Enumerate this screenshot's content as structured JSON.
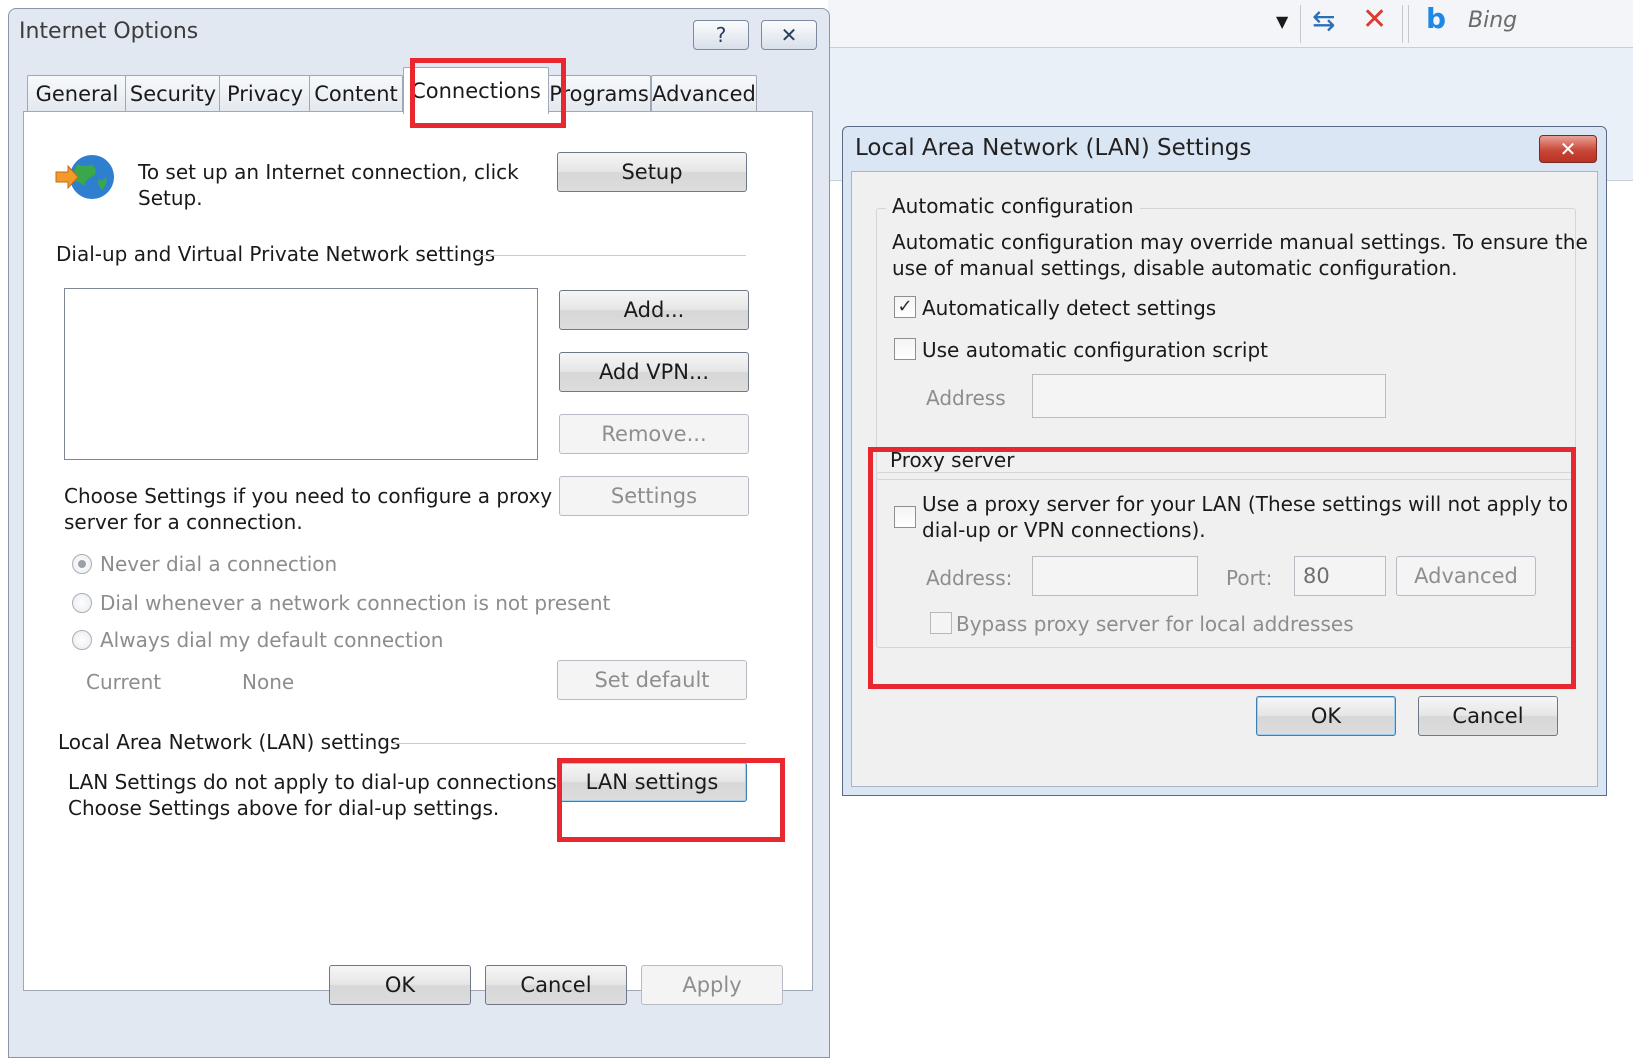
{
  "browser": {
    "search_provider": "Bing"
  },
  "internet_options": {
    "title": "Internet Options",
    "help_glyph": "?",
    "close_glyph": "✕",
    "tabs": [
      "General",
      "Security",
      "Privacy",
      "Content",
      "Connections",
      "Programs",
      "Advanced"
    ],
    "active_tab": "Connections",
    "setup_text_line1": "To set up an Internet connection, click",
    "setup_text_line2": "Setup.",
    "setup_button": "Setup",
    "dialup_group_label": "Dial-up and Virtual Private Network settings",
    "add_button": "Add...",
    "add_vpn_button": "Add VPN...",
    "remove_button": "Remove...",
    "settings_button": "Settings",
    "proxy_hint_line1": "Choose Settings if you need to configure a proxy",
    "proxy_hint_line2": "server for a connection.",
    "radio_never": "Never dial a connection",
    "radio_whenever": "Dial whenever a network connection is not present",
    "radio_always": "Always dial my default connection",
    "current_label": "Current",
    "current_value": "None",
    "set_default_button": "Set default",
    "lan_group_label": "Local Area Network (LAN) settings",
    "lan_text_line1": "LAN Settings do not apply to dial-up connections.",
    "lan_text_line2": "Choose Settings above for dial-up settings.",
    "lan_settings_button": "LAN settings",
    "ok_button": "OK",
    "cancel_button": "Cancel",
    "apply_button": "Apply"
  },
  "lan_dialog": {
    "title": "Local Area Network (LAN) Settings",
    "close_glyph": "✕",
    "auto_config_label": "Automatic configuration",
    "auto_config_desc_line1": "Automatic configuration may override manual settings.  To ensure the",
    "auto_config_desc_line2": "use of manual settings, disable automatic configuration.",
    "auto_detect_label": "Automatically detect settings",
    "auto_detect_checked": true,
    "auto_detect_mark": "✓",
    "auto_script_label": "Use automatic configuration script",
    "auto_script_checked": false,
    "script_address_label": "Address",
    "script_address_value": "",
    "proxy_group_label": "Proxy server",
    "use_proxy_line1": "Use a proxy server for your LAN (These settings will not apply to",
    "use_proxy_line2": "dial-up or VPN connections).",
    "use_proxy_checked": false,
    "proxy_address_label": "Address:",
    "proxy_address_value": "",
    "port_label": "Port:",
    "port_value": "80",
    "advanced_button": "Advanced",
    "bypass_label": "Bypass proxy server for local addresses",
    "bypass_checked": false,
    "ok_button": "OK",
    "cancel_button": "Cancel"
  },
  "colors": {
    "highlight_red": "#e8272e",
    "bing_blue": "#1e88e5",
    "stop_red": "#e03a2e"
  }
}
